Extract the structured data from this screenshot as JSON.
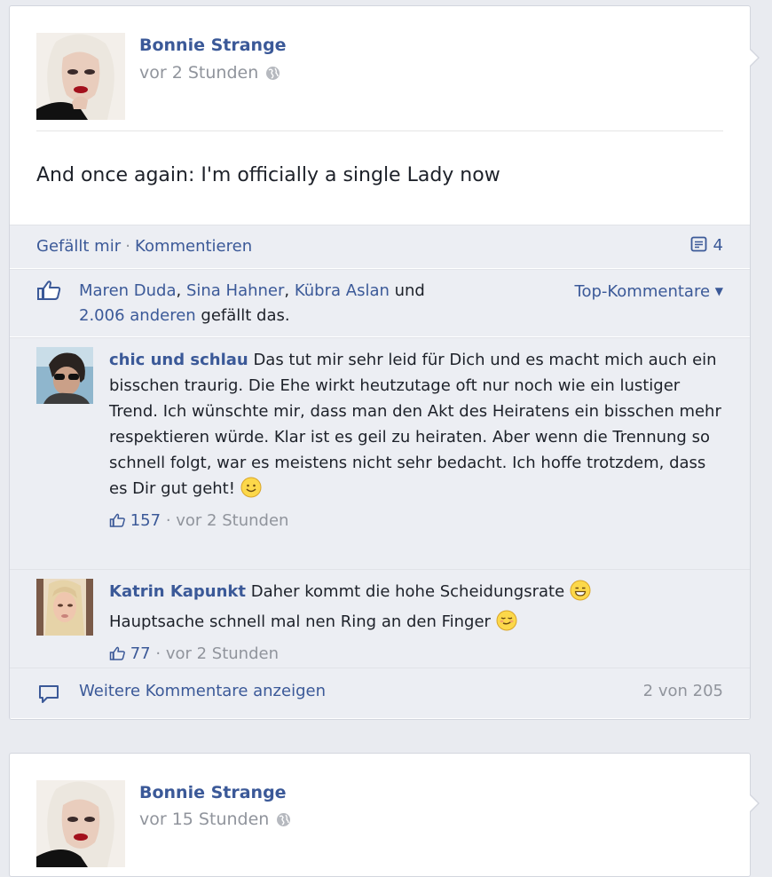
{
  "posts": [
    {
      "author": "Bonnie Strange",
      "time": "vor 2 Stunden",
      "text": "And once again: I'm officially a single Lady now",
      "actions": {
        "like": "Gefällt mir",
        "separator": "·",
        "comment": "Kommentieren",
        "comment_count": "4"
      },
      "likes": {
        "names": [
          "Maren Duda",
          "Sina Hahner",
          "Kübra Aslan"
        ],
        "sep1": ", ",
        "sep2": ", ",
        "and": " und",
        "others": "2.006 anderen",
        "suffix": " gefällt das.",
        "sort_label": "Top-Kommentare"
      },
      "comments": [
        {
          "name": "chic und schlau",
          "text": "Das tut mir sehr leid für Dich und es macht mich auch ein bisschen traurig. Die Ehe wirkt heutzutage oft nur noch wie ein lustiger Trend. Ich wünschte mir, dass man den Akt des Heiratens ein bisschen mehr respektieren würde. Klar ist es geil zu heiraten. Aber wenn die Trennung so schnell folgt, war es meistens nicht sehr bedacht. Ich hoffe trotzdem, dass es Dir gut geht!",
          "likes": "157",
          "time": "vor 2 Stunden"
        },
        {
          "name": "Katrin Kapunkt",
          "text_part1": "Daher kommt die hohe Scheidungsrate",
          "text_part2": "Hauptsache schnell mal nen Ring an den Finger",
          "likes": "77",
          "time": "vor 2 Stunden"
        }
      ],
      "more_comments": {
        "label": "Weitere Kommentare anzeigen",
        "count": "2 von 205"
      }
    },
    {
      "author": "Bonnie Strange",
      "time": "vor 15 Stunden"
    }
  ],
  "meta_sep": " · "
}
